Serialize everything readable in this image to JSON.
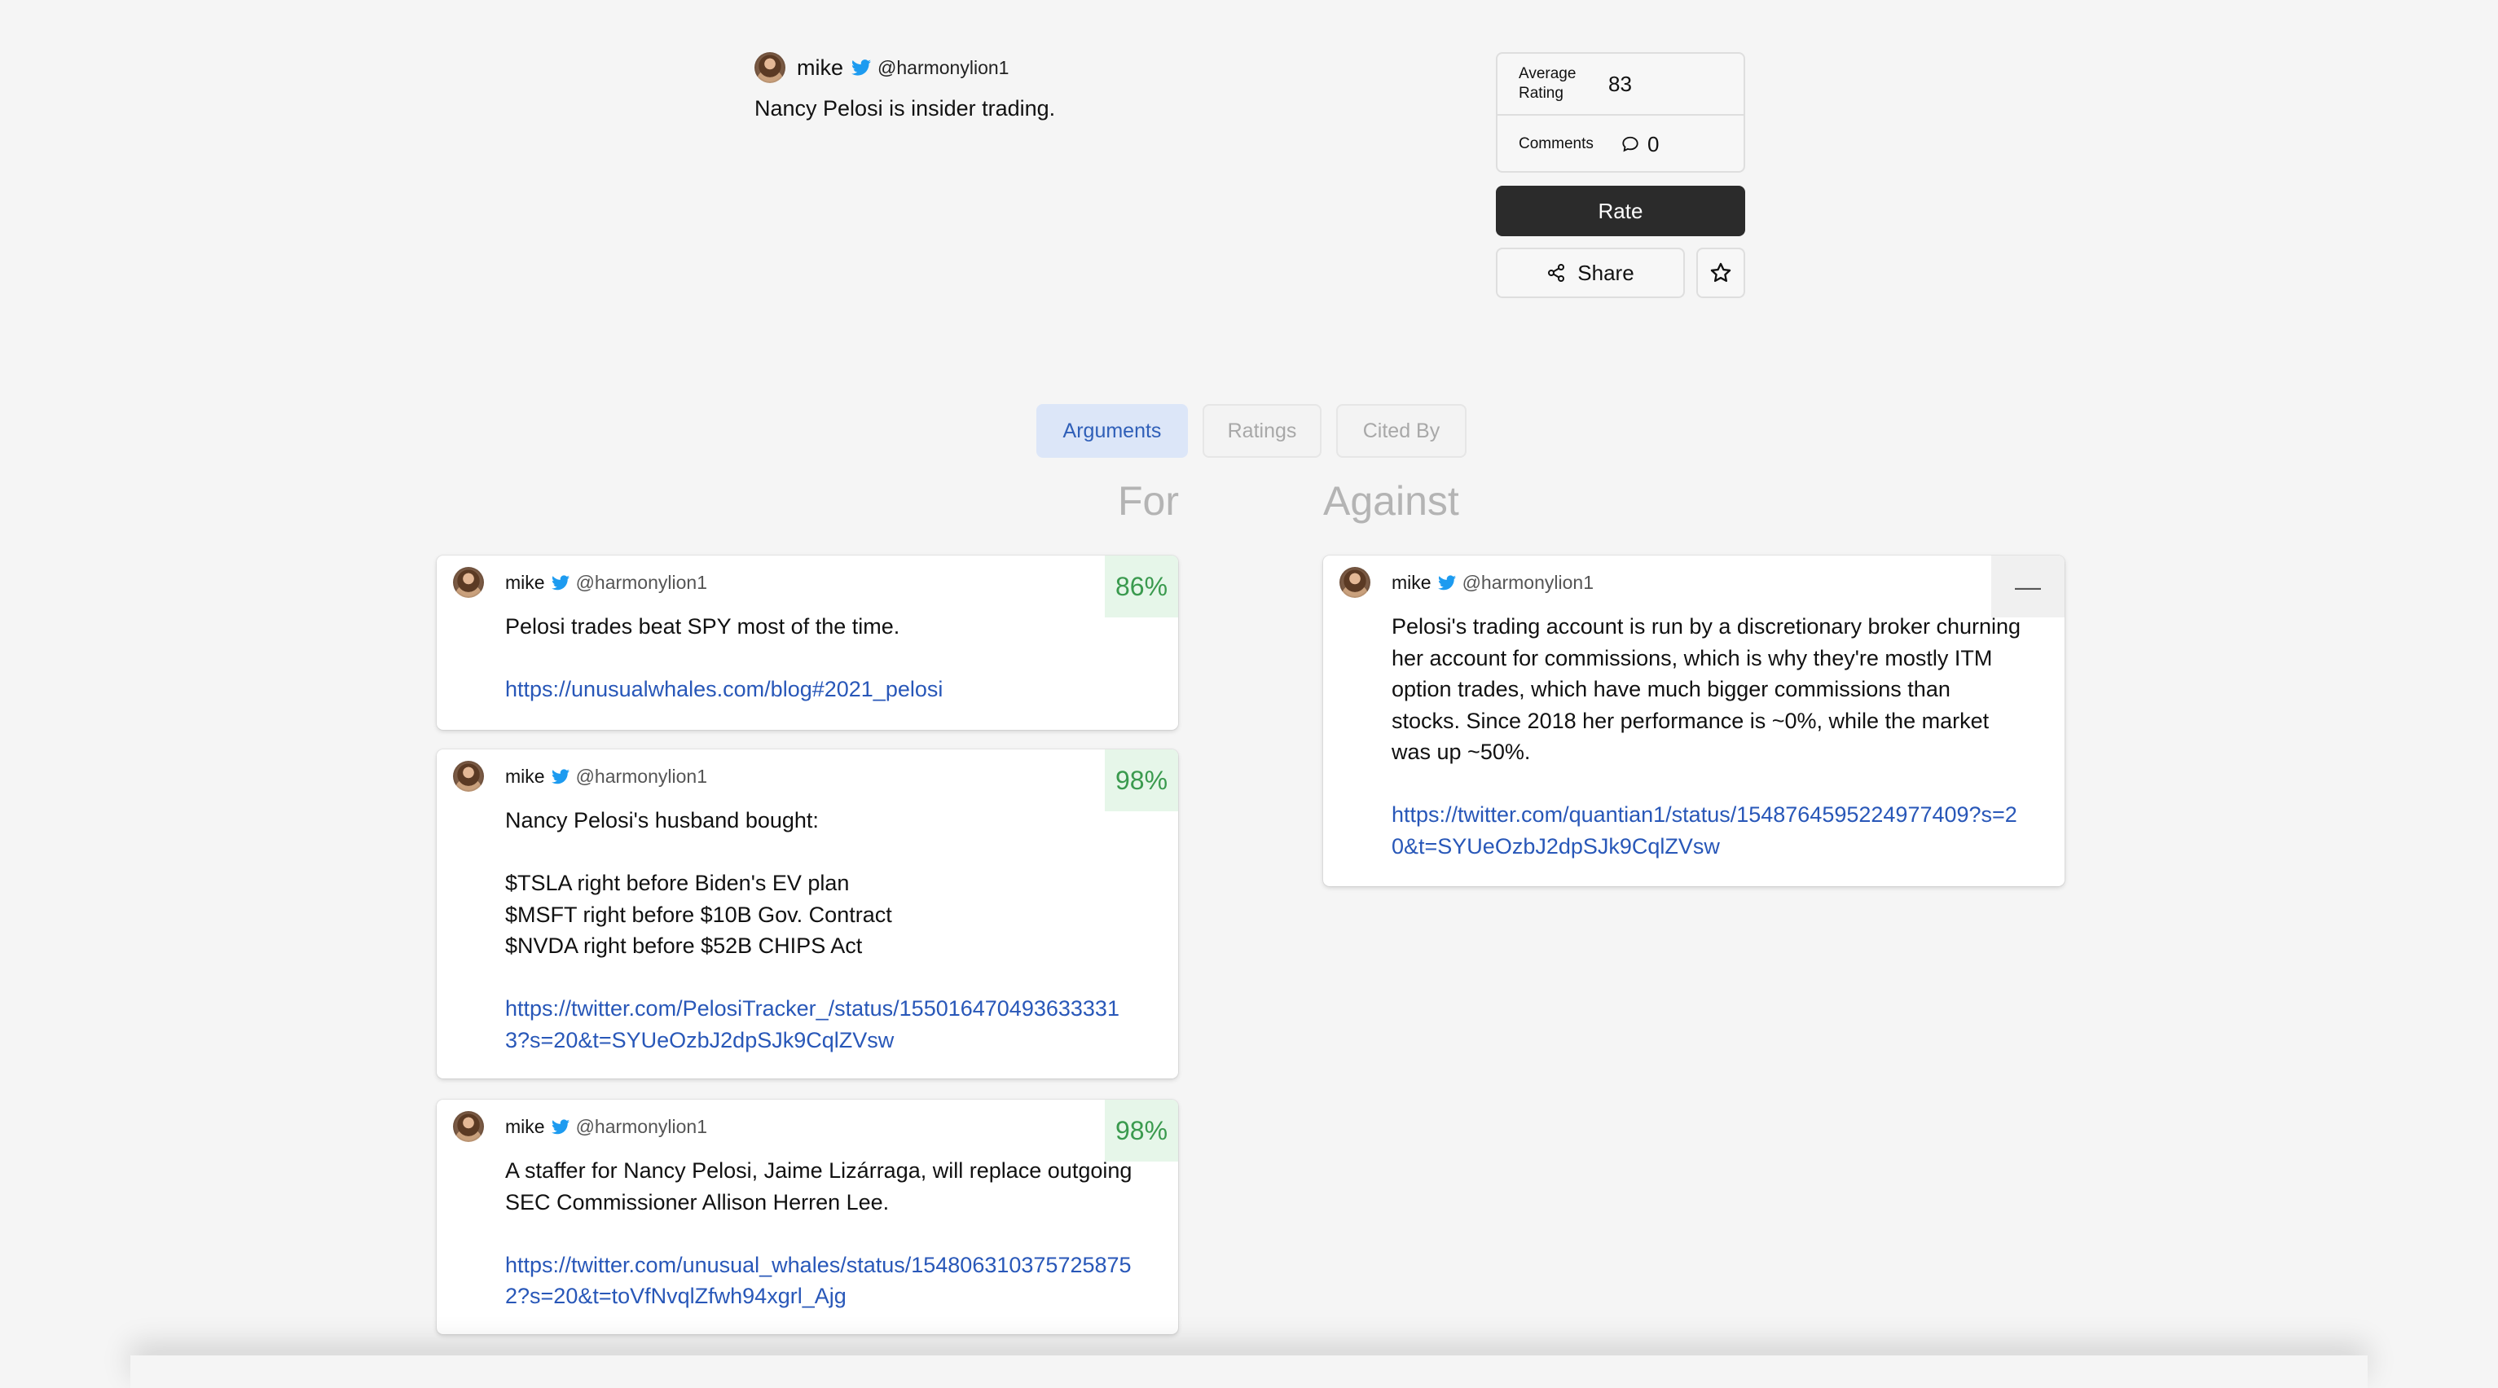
{
  "claim": {
    "author_name": "mike",
    "author_handle": "@harmonylion1",
    "text": "Nancy Pelosi is insider trading."
  },
  "stats": {
    "average_rating_label": "Average Rating",
    "average_rating_value": "83",
    "comments_label": "Comments",
    "comments_value": "0"
  },
  "actions": {
    "rate_label": "Rate",
    "share_label": "Share"
  },
  "tabs": [
    {
      "label": "Arguments",
      "active": true
    },
    {
      "label": "Ratings",
      "active": false
    },
    {
      "label": "Cited By",
      "active": false
    }
  ],
  "columns": {
    "for_label": "For",
    "against_label": "Against"
  },
  "for_arguments": [
    {
      "author_name": "mike",
      "author_handle": "@harmonylion1",
      "score": "86%",
      "text": "Pelosi trades beat SPY most of the time.",
      "link": "https://unusualwhales.com/blog#2021_pelosi"
    },
    {
      "author_name": "mike",
      "author_handle": "@harmonylion1",
      "score": "98%",
      "text": "Nancy Pelosi's husband bought:\n\n$TSLA right before Biden's EV plan\n$MSFT right before $10B Gov. Contract\n$NVDA right before $52B CHIPS Act",
      "link": "https://twitter.com/PelosiTracker_/status/1550164704936333313?s=20&t=SYUeOzbJ2dpSJk9CqlZVsw"
    },
    {
      "author_name": "mike",
      "author_handle": "@harmonylion1",
      "score": "98%",
      "text": "A staffer for Nancy Pelosi, Jaime Lizárraga, will replace outgoing SEC Commissioner Allison Herren Lee.",
      "link": "https://twitter.com/unusual_whales/status/1548063103757258752?s=20&t=toVfNvqlZfwh94xgrl_Ajg"
    }
  ],
  "against_arguments": [
    {
      "author_name": "mike",
      "author_handle": "@harmonylion1",
      "score": "—",
      "text": "Pelosi's trading account is run by a discretionary broker churning her account for commissions, which is why they're mostly ITM option trades, which have much bigger commissions than stocks. Since 2018 her performance is ~0%, while the market was up ~50%.",
      "link": "https://twitter.com/quantian1/status/1548764595224977409?s=20&t=SYUeOzbJ2dpSJk9CqlZVsw"
    }
  ],
  "colors": {
    "background": "#f5f5f5",
    "accent_blue": "#2857b8",
    "badge_green": "#3a9a4e",
    "twitter_blue": "#1d9bf0",
    "rate_button": "#2b2b2b"
  },
  "icons": [
    "twitter-bird-icon",
    "comment-icon",
    "share-icon",
    "star-icon"
  ]
}
